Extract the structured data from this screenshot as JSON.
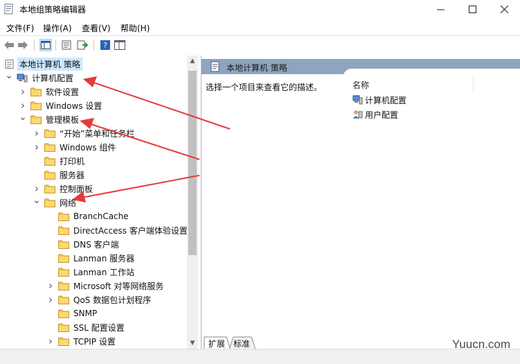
{
  "window": {
    "title": "本地组策略编辑器",
    "controls": {
      "minimize": "minimize-icon",
      "maximize": "maximize-icon",
      "close": "close-icon"
    }
  },
  "menu": [
    "文件(F)",
    "操作(A)",
    "查看(V)",
    "帮助(H)"
  ],
  "toolbar": [
    "back-icon",
    "forward-icon",
    "show-tree-icon",
    "properties-icon",
    "export-icon",
    "help-icon",
    "extended-view-icon"
  ],
  "tree": {
    "root": "本地计算机 策略",
    "items": [
      {
        "label": "计算机配置",
        "state": "expanded",
        "icon": "computer-config-icon"
      },
      {
        "label": "软件设置",
        "state": "collapsed"
      },
      {
        "label": "Windows 设置",
        "state": "collapsed"
      },
      {
        "label": "管理模板",
        "state": "expanded"
      },
      {
        "label": "“开始”菜单和任务栏",
        "state": "collapsed"
      },
      {
        "label": "Windows 组件",
        "state": "collapsed"
      },
      {
        "label": "打印机",
        "state": "none"
      },
      {
        "label": "服务器",
        "state": "none"
      },
      {
        "label": "控制面板",
        "state": "collapsed"
      },
      {
        "label": "网络",
        "state": "expanded"
      },
      {
        "label": "BranchCache",
        "state": "none"
      },
      {
        "label": "DirectAccess 客户端体验设置",
        "state": "none"
      },
      {
        "label": "DNS 客户端",
        "state": "none"
      },
      {
        "label": "Lanman 服务器",
        "state": "none"
      },
      {
        "label": "Lanman 工作站",
        "state": "none"
      },
      {
        "label": "Microsoft 对等网络服务",
        "state": "collapsed"
      },
      {
        "label": "QoS 数据包计划程序",
        "state": "collapsed"
      },
      {
        "label": "SNMP",
        "state": "none"
      },
      {
        "label": "SSL 配置设置",
        "state": "none"
      },
      {
        "label": "TCPIP 设置",
        "state": "collapsed"
      }
    ]
  },
  "right": {
    "header": "本地计算机 策略",
    "description": "选择一个项目来查看它的描述。",
    "column": "名称",
    "items": [
      {
        "label": "计算机配置",
        "icon": "computer-config-icon"
      },
      {
        "label": "用户配置",
        "icon": "user-config-icon"
      }
    ],
    "tabs": [
      "扩展",
      "标准"
    ]
  },
  "watermark": "Yuucn.com",
  "colors": {
    "header_bg": "#8fa5bf",
    "selection": "#cce8ff",
    "folder": "#f3c54f",
    "arrow": "#e33b3b"
  }
}
